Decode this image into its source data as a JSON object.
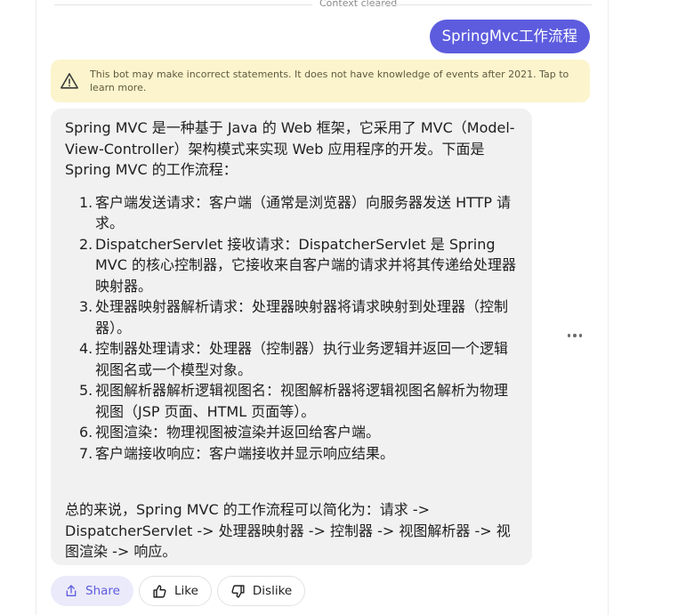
{
  "context": {
    "cleared_label": "Context cleared"
  },
  "user_message": {
    "text": "SpringMvc工作流程"
  },
  "warning": {
    "text": "This bot may make incorrect statements. It does not have knowledge of events after 2021. Tap to learn more.",
    "icon": "warning-triangle-icon"
  },
  "bot_message": {
    "intro": "Spring MVC 是一种基于 Java 的 Web 框架，它采用了 MVC（Model-View-Controller）架构模式来实现 Web 应用程序的开发。下面是 Spring MVC 的工作流程：",
    "steps": [
      {
        "num": "1.",
        "text": "客户端发送请求：客户端（通常是浏览器）向服务器发送 HTTP 请求。"
      },
      {
        "num": "2.",
        "text": "DispatcherServlet 接收请求：DispatcherServlet 是 Spring MVC 的核心控制器，它接收来自客户端的请求并将其传递给处理器映射器。"
      },
      {
        "num": "3.",
        "text": "处理器映射器解析请求：处理器映射器将请求映射到处理器（控制器）。"
      },
      {
        "num": "4.",
        "text": "控制器处理请求：处理器（控制器）执行业务逻辑并返回一个逻辑视图名或一个模型对象。"
      },
      {
        "num": "5.",
        "text": "视图解析器解析逻辑视图名：视图解析器将逻辑视图名解析为物理视图（JSP 页面、HTML 页面等）。"
      },
      {
        "num": "6.",
        "text": "视图渲染：物理视图被渲染并返回给客户端。"
      },
      {
        "num": "7.",
        "text": "客户端接收响应：客户端接收并显示响应结果。"
      }
    ],
    "summary": "总的来说，Spring MVC 的工作流程可以简化为：请求 -> DispatcherServlet -> 处理器映射器 -> 控制器 -> 视图解析器 -> 视图渲染 -> 响应。"
  },
  "actions": {
    "share_label": "Share",
    "like_label": "Like",
    "dislike_label": "Dislike"
  },
  "colors": {
    "accent": "#5d5cde",
    "warning_bg": "#fcf4cc",
    "bubble_bg": "#f1f1f1"
  }
}
